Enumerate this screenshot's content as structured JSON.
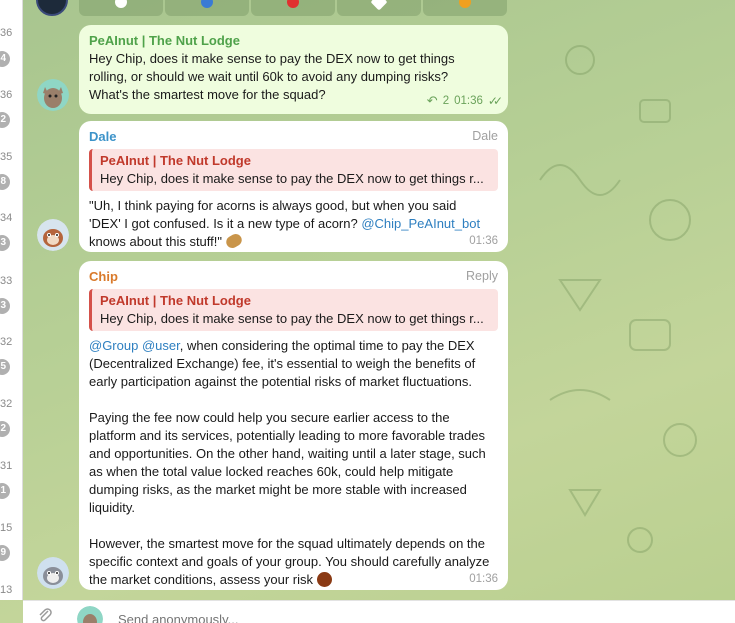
{
  "left_strip": {
    "items": [
      {
        "time": "36",
        "badge": ""
      },
      {
        "time": "",
        "badge": "4"
      },
      {
        "time": "36",
        "badge": "2"
      },
      {
        "time": "35",
        "badge": "8"
      },
      {
        "time": "34",
        "badge": "3"
      },
      {
        "time": "33",
        "badge": "3"
      },
      {
        "time": "32",
        "badge": "5"
      },
      {
        "time": "32",
        "badge": "2"
      },
      {
        "time": "31",
        "badge": "1"
      },
      {
        "time": "15",
        "badge": "9"
      },
      {
        "time": "13",
        "badge": ""
      }
    ]
  },
  "top_buttons": [
    {
      "icon": "white-circle-icon",
      "color": "#ffffff"
    },
    {
      "icon": "blue-circle-icon",
      "color": "#3a7bd5"
    },
    {
      "icon": "red-heart-icon",
      "color": "#e03030"
    },
    {
      "icon": "white-diamond-icon",
      "color": "#ffffff"
    },
    {
      "icon": "orange-fire-icon",
      "color": "#f0a020"
    }
  ],
  "messages": [
    {
      "sender": "PeAInut | The Nut Lodge",
      "sender_color": "#4fa24a",
      "text": "Hey Chip, does it make sense to pay the DEX now to get things rolling, or should we wait until 60k to avoid any dumping risks? What's the smartest move for the squad?",
      "replies": "2",
      "time": "01:36",
      "status": "double-check-icon"
    },
    {
      "sender": "Dale",
      "sender_color": "#3c93c9",
      "role": "Dale",
      "quote_name": "PeAInut | The Nut Lodge",
      "quote_text": "Hey Chip, does it make sense to pay the DEX now to get things r...",
      "text_before": "\"Uh, I think paying for acorns is always good, but when you said 'DEX' I got confused. Is it a new type of acorn? ",
      "mention": "@Chip_PeAInut_bot",
      "text_after": " knows about this stuff!\"",
      "emoji": "peanut-icon",
      "time": "01:36"
    },
    {
      "sender": "Chip",
      "sender_color": "#d97a2b",
      "role": "Reply",
      "quote_name": "PeAInut | The Nut Lodge",
      "quote_text": "Hey Chip, does it make sense to pay the DEX now to get things r...",
      "mention1": "@Group",
      "mention2": "@user",
      "p1": ", when considering the optimal time to pay the DEX (Decentralized Exchange) fee, it's essential to weigh the benefits of early participation against the potential risks of market fluctuations.",
      "p2": "Paying the fee now could help you secure earlier access to the platform and its services, potentially leading to more favorable trades and opportunities. On the other hand, waiting until a later stage, such as when the total value locked reaches 60k, could help mitigate dumping risks, as the market might be more stable with increased liquidity.",
      "p3": "However, the smartest move for the squad ultimately depends on the specific context and goals of your group. You should carefully analyze the market conditions, assess your risk",
      "emoji": "nut-icon",
      "time": "01:36"
    }
  ],
  "composer": {
    "placeholder": "Send anonymously..."
  }
}
